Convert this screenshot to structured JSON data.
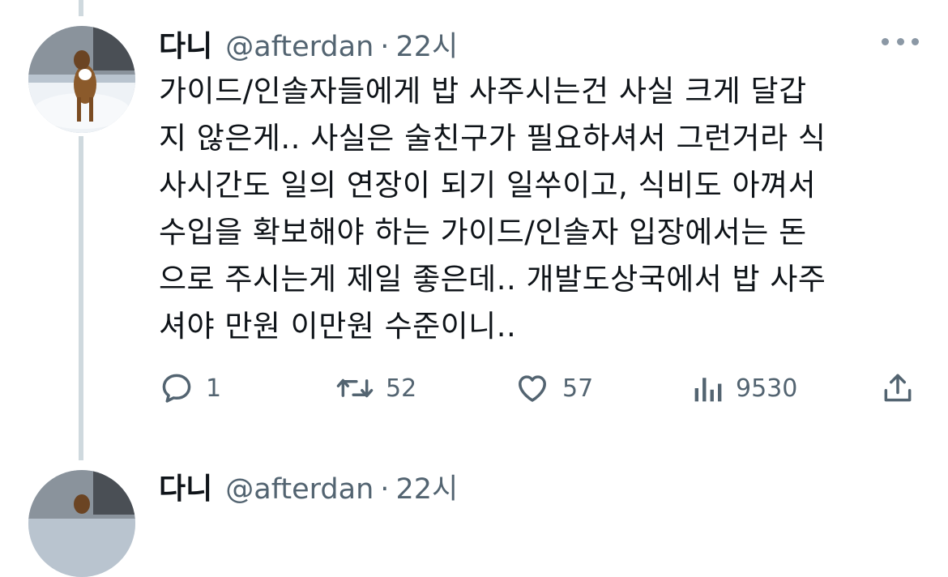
{
  "tweet": {
    "display_name": "다니",
    "handle": "@afterdan",
    "separator": "·",
    "time": "22시",
    "text_lines": [
      "가이드/인솔자들에게 밥 사주시는건 사실 크게 달갑",
      "지 않은게.. 사실은 술친구가 필요하셔서 그런거라 식",
      "사시간도 일의 연장이 되기 일쑤이고, 식비도 아껴서",
      "수입을 확보해야 하는 가이드/인솔자 입장에서는 돈",
      "으로 주시는게 제일 좋은데.. 개발도상국에서 밥 사주",
      "셔야 만원 이만원 수준이니.."
    ],
    "actions": {
      "reply_count": "1",
      "retweet_count": "52",
      "like_count": "57",
      "view_count": "9530"
    },
    "icons": {
      "reply": "reply-icon",
      "retweet": "retweet-icon",
      "like": "heart-icon",
      "views": "views-icon",
      "share": "share-icon",
      "more": "more-icon"
    }
  },
  "next_tweet": {
    "display_name": "다니",
    "handle": "@afterdan",
    "separator": "·",
    "time": "22시"
  },
  "colors": {
    "text_primary": "#0f1419",
    "text_secondary": "#536471",
    "thread_line": "#cfd9de"
  }
}
